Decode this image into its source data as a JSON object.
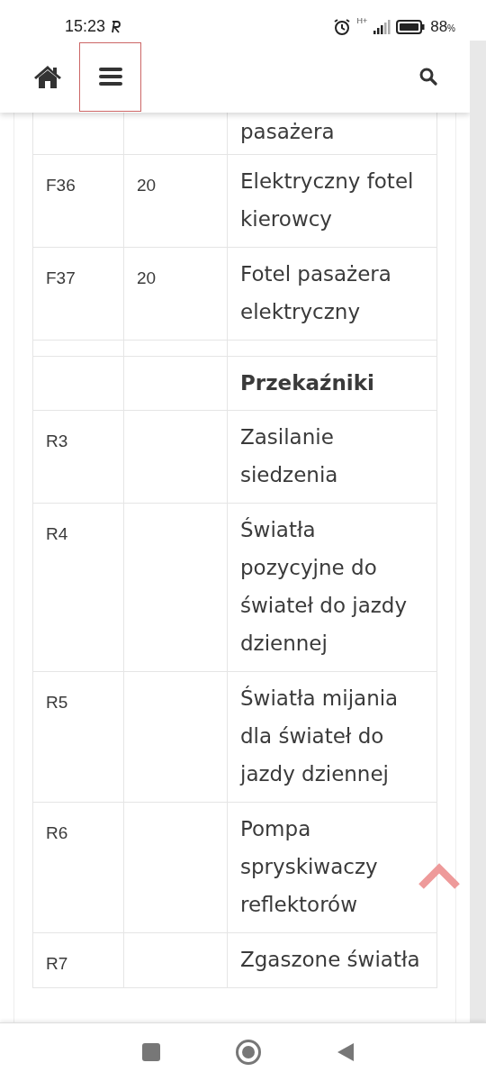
{
  "status_bar": {
    "time": "15:23",
    "network": "H+",
    "battery": "88",
    "battery_unit": "%"
  },
  "rows": [
    {
      "kind": "data",
      "code": "",
      "amps": "",
      "text": "pasażera"
    },
    {
      "kind": "data",
      "code": "F36",
      "amps": "20",
      "text": "Elektryczny fotel kierowcy"
    },
    {
      "kind": "data",
      "code": "F37",
      "amps": "20",
      "text": "Fotel pasażera elektryczny"
    },
    {
      "kind": "spacer"
    },
    {
      "kind": "heading",
      "text": "Przekaźniki"
    },
    {
      "kind": "data",
      "code": "R3",
      "amps": "",
      "text": "Zasilanie siedzenia"
    },
    {
      "kind": "data",
      "code": "R4",
      "amps": "",
      "text": "Światła pozycyjne do świateł do jazdy dziennej"
    },
    {
      "kind": "data",
      "code": "R5",
      "amps": "",
      "text": "Światła mijania dla świateł do jazdy dziennej"
    },
    {
      "kind": "data",
      "code": "R6",
      "amps": "",
      "text": "Pompa spryskiwaczy reflektorów"
    },
    {
      "kind": "data",
      "code": "R7",
      "amps": "",
      "text": "Zgaszone światła"
    }
  ]
}
